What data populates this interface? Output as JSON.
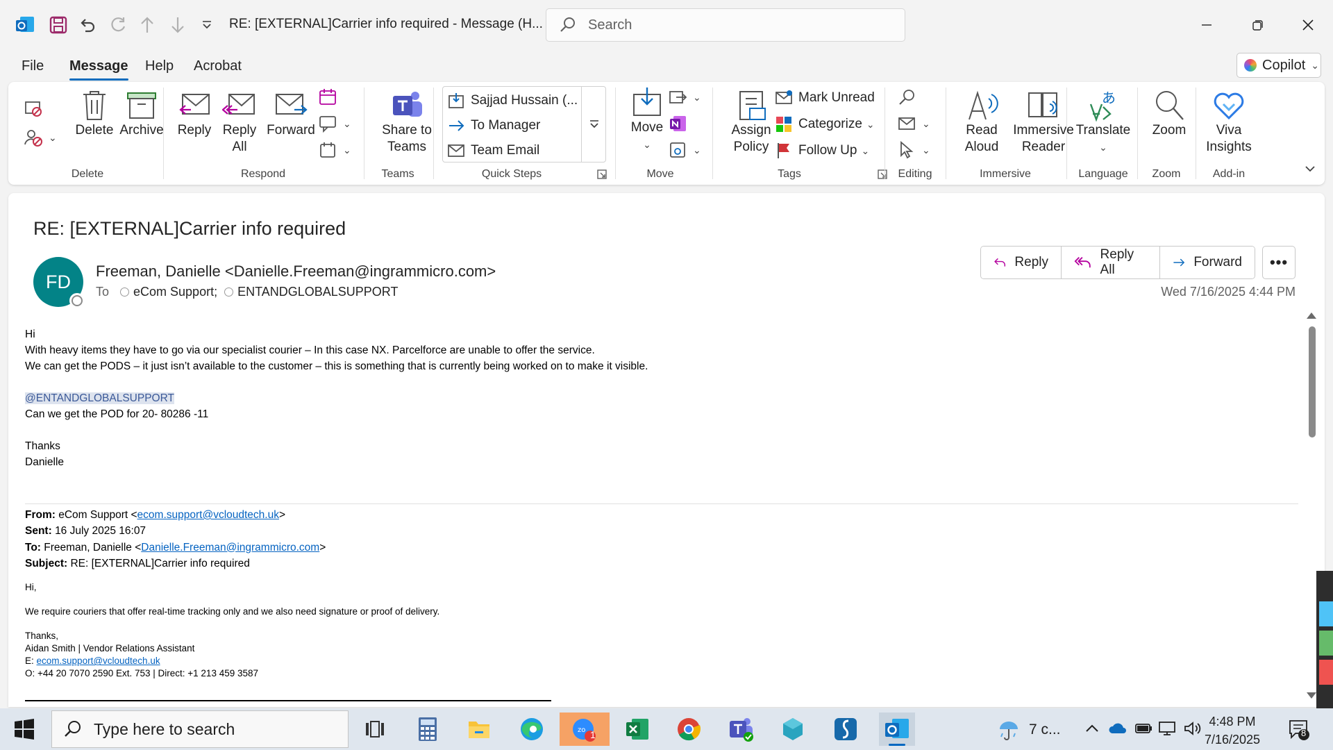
{
  "window": {
    "title": "RE: [EXTERNAL]Carrier info required  -  Message (H...",
    "search_placeholder": "Search"
  },
  "menu": {
    "tabs": [
      "File",
      "Message",
      "Help",
      "Acrobat"
    ],
    "active_tab": "Message",
    "copilot_label": "Copilot"
  },
  "ribbon": {
    "delete_group": {
      "label": "Delete",
      "delete": "Delete",
      "archive": "Archive"
    },
    "respond_group": {
      "label": "Respond",
      "reply": "Reply",
      "reply_all": "Reply All",
      "forward": "Forward"
    },
    "teams_group": {
      "label": "Teams",
      "share": "Share to Teams"
    },
    "quick_steps": {
      "label": "Quick Steps",
      "items": [
        "Sajjad Hussain (...",
        "To Manager",
        "Team Email"
      ]
    },
    "move_group": {
      "label": "Move",
      "move": "Move"
    },
    "tags_group": {
      "label": "Tags",
      "assign_policy": "Assign Policy",
      "mark_unread": "Mark Unread",
      "categorize": "Categorize",
      "follow_up": "Follow Up"
    },
    "editing_group": {
      "label": "Editing"
    },
    "immersive_group": {
      "label": "Immersive",
      "read_aloud": "Read Aloud",
      "immersive_reader": "Immersive Reader"
    },
    "language_group": {
      "label": "Language",
      "translate": "Translate"
    },
    "zoom_group": {
      "label": "Zoom",
      "zoom": "Zoom"
    },
    "addin_group": {
      "label": "Add-in",
      "viva": "Viva Insights"
    }
  },
  "message": {
    "subject": "RE: [EXTERNAL]Carrier info required",
    "avatar_initials": "FD",
    "avatar_color": "#038387",
    "sender": "Freeman, Danielle <Danielle.Freeman@ingrammicro.com>",
    "to_label": "To",
    "recipients": [
      "eCom Support;",
      "ENTANDGLOBALSUPPORT"
    ],
    "actions": {
      "reply": "Reply",
      "reply_all": "Reply All",
      "forward": "Forward"
    },
    "datetime": "Wed 7/16/2025 4:44 PM",
    "body": {
      "greeting": "Hi",
      "line1": "With heavy items they have to go via our specialist courier – In this case NX. Parcelforce are unable to offer the service.",
      "line2": "We can get the PODS – it just isn’t available to the customer – this is something that is currently being worked on to make it visible.",
      "mention": "@ENTANDGLOBALSUPPORT",
      "line3": "Can we get the POD for 20- 80286 -11",
      "thanks": "Thanks",
      "signoff": "Danielle"
    },
    "quoted": {
      "from_label": "From:",
      "from_name": "eCom Support <",
      "from_email": "ecom.support@vcloudtech.uk",
      "from_close": ">",
      "sent_label": "Sent:",
      "sent": "16 July 2025 16:07",
      "to_label": "To:",
      "to_name": "Freeman, Danielle <",
      "to_email": "Danielle.Freeman@ingrammicro.com",
      "to_close": ">",
      "subject_label": "Subject:",
      "subject": "RE: [EXTERNAL]Carrier info required",
      "hi": "Hi,",
      "body": "We require couriers that offer real-time tracking only and we also need signature or proof of delivery.",
      "thanks": "Thanks,",
      "sig_name": "Aidan Smith | Vendor Relations Assistant",
      "sig_e_label": "E:",
      "sig_email": "ecom.support@vcloudtech.uk",
      "sig_phone": "O:  +44 20 7070 2590 Ext. 753 | Direct: +1 213 459 3587"
    }
  },
  "taskbar": {
    "search_placeholder": "Type here to search",
    "weather": "7 c...",
    "time": "4:48 PM",
    "date": "7/16/2025",
    "notification_count": "8",
    "zoom_badge": "1"
  }
}
